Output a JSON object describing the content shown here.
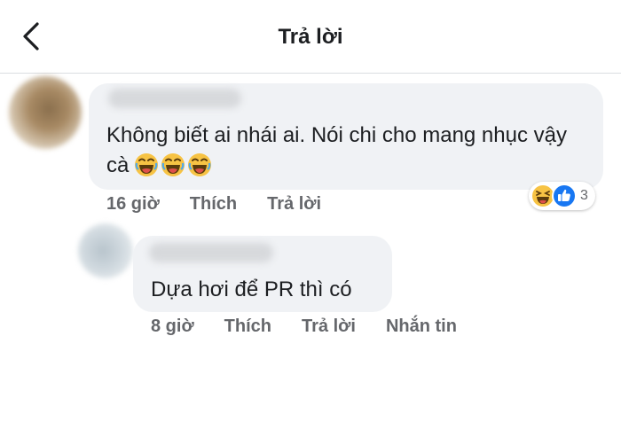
{
  "header": {
    "title": "Trả lời"
  },
  "comments": [
    {
      "text": "Không biết ai nhái ai. Nói chi cho mang nhục vậy cà",
      "time": "16 giờ",
      "like_label": "Thích",
      "reply_label": "Trả lời",
      "reactions": {
        "icons": [
          "haha-icon",
          "like-icon"
        ],
        "count": "3"
      },
      "emojis": [
        "laughing-emoji",
        "laughing-emoji",
        "laughing-emoji"
      ]
    },
    {
      "text": "Dựa hơi để PR thì có",
      "time": "8 giờ",
      "like_label": "Thích",
      "reply_label": "Trả lời",
      "message_label": "Nhắn tin"
    }
  ],
  "colors": {
    "bubble": "#f0f2f5",
    "meta_text": "#65676b",
    "like_blue": "#1877f2",
    "haha_yellow": "#f7c344"
  }
}
